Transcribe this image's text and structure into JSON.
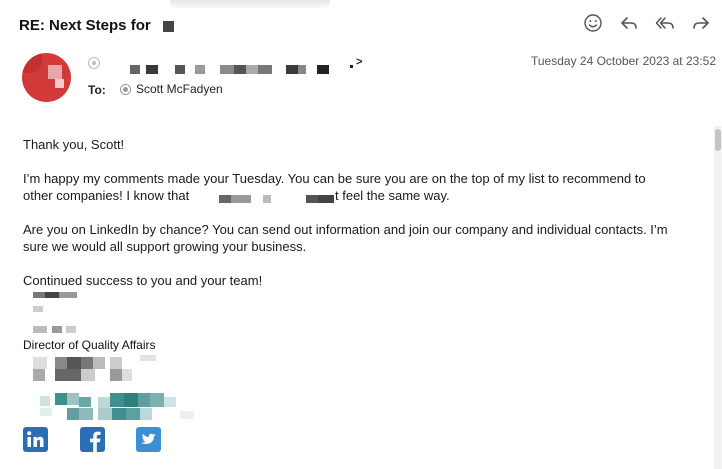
{
  "header": {
    "subject": "RE: Next Steps for",
    "actions": {
      "emoji_icon": "smiley-icon",
      "reply_icon": "reply-icon",
      "reply_all_icon": "reply-all-icon",
      "forward_icon": "forward-icon"
    }
  },
  "meta": {
    "from_suffix": ">",
    "to_label": "To:",
    "to_name": "Scott McFadyen",
    "date": "Tuesday 24 October 2023 at 23:52"
  },
  "body": {
    "greeting": "Thank you, Scott!",
    "para1_line1": "I’m happy my comments made your Tuesday.  You can be sure you are on the top of my list to recommend to",
    "para1_line2_a": "other companies!  I know that",
    "para1_line2_b": "t feel the same way.",
    "para2_line1": "Are you on LinkedIn by chance?  You can send out information and join our company and individual contacts.  I’m",
    "para2_line2": "sure we would all support growing your business.",
    "closing": "Continued success to you and your team!"
  },
  "signature": {
    "title": "Director of Quality Affairs",
    "social": [
      "linkedin-icon",
      "facebook-icon",
      "twitter-icon"
    ]
  },
  "colors": {
    "avatar": "#d23a3a",
    "linkedin": "#2a6fb5",
    "facebook": "#2a6fb5",
    "twitter": "#3a8fd5",
    "redact_teal": "#3f8f8f"
  }
}
